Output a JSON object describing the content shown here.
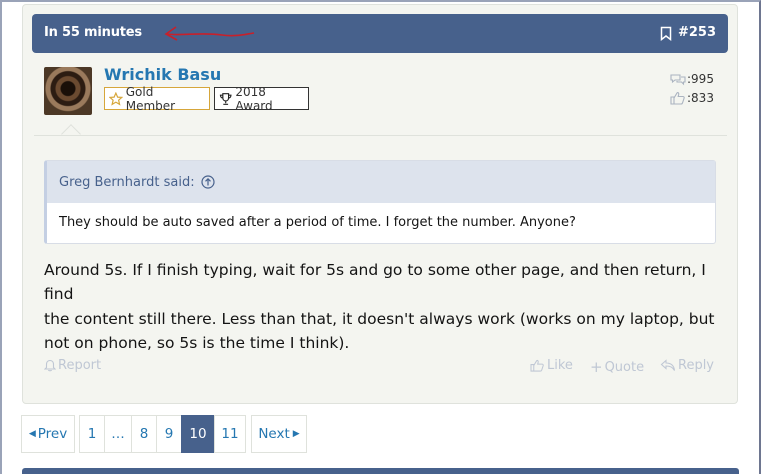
{
  "post": {
    "time": "In 55 minutes",
    "number": "#253",
    "colors": {
      "header": "#47618c",
      "link": "#2577b1",
      "annotation": "#c8202a"
    }
  },
  "author": {
    "name": "Wrichik Basu",
    "badges": [
      "Gold Member",
      "2018 Award"
    ],
    "messages": ":995",
    "likes": ":833"
  },
  "quote": {
    "attribution": "Greg Bernhardt said:",
    "text": "They should be auto saved after a period of time. I forget the number. Anyone?"
  },
  "message": {
    "lines": [
      "Around 5s. If I finish typing, wait for 5s and go to some other page, and then return, I find",
      "the content still there. Less than that, it doesn't always work (works on my laptop, but",
      "not on phone, so 5s is the time I think)."
    ]
  },
  "actions": {
    "report": "Report",
    "like": "Like",
    "quote": "Quote",
    "reply": "Reply"
  },
  "pagination": {
    "prev": "Prev",
    "pages": [
      "1",
      "…",
      "8",
      "9",
      "10",
      "11"
    ],
    "current": "10",
    "next": "Next"
  }
}
